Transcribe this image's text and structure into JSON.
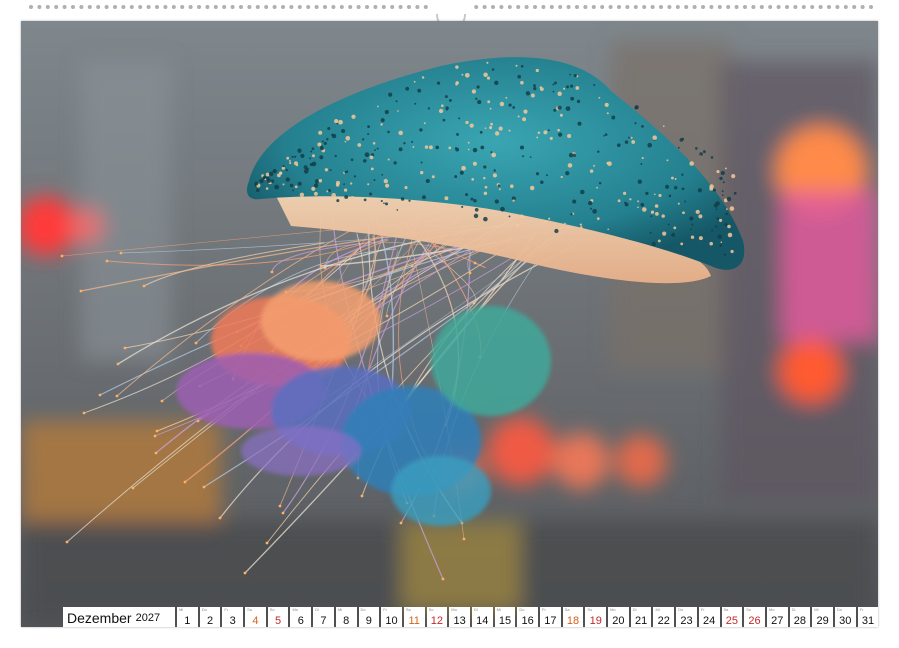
{
  "calendar": {
    "month": "Dezember",
    "year": "2027",
    "days": [
      {
        "n": "1",
        "wd": "Mi",
        "type": "weekday"
      },
      {
        "n": "2",
        "wd": "Do",
        "type": "weekday"
      },
      {
        "n": "3",
        "wd": "Fr",
        "type": "weekday"
      },
      {
        "n": "4",
        "wd": "Sa",
        "type": "sat"
      },
      {
        "n": "5",
        "wd": "So",
        "type": "sun"
      },
      {
        "n": "6",
        "wd": "Mo",
        "type": "weekday"
      },
      {
        "n": "7",
        "wd": "Di",
        "type": "weekday"
      },
      {
        "n": "8",
        "wd": "Mi",
        "type": "weekday"
      },
      {
        "n": "9",
        "wd": "Do",
        "type": "weekday"
      },
      {
        "n": "10",
        "wd": "Fr",
        "type": "weekday"
      },
      {
        "n": "11",
        "wd": "Sa",
        "type": "sat"
      },
      {
        "n": "12",
        "wd": "So",
        "type": "sun"
      },
      {
        "n": "13",
        "wd": "Mo",
        "type": "weekday"
      },
      {
        "n": "14",
        "wd": "Di",
        "type": "weekday"
      },
      {
        "n": "15",
        "wd": "Mi",
        "type": "weekday"
      },
      {
        "n": "16",
        "wd": "Do",
        "type": "weekday"
      },
      {
        "n": "17",
        "wd": "Fr",
        "type": "weekday"
      },
      {
        "n": "18",
        "wd": "Sa",
        "type": "sat"
      },
      {
        "n": "19",
        "wd": "So",
        "type": "sun"
      },
      {
        "n": "20",
        "wd": "Mo",
        "type": "weekday"
      },
      {
        "n": "21",
        "wd": "Di",
        "type": "weekday"
      },
      {
        "n": "22",
        "wd": "Mi",
        "type": "weekday"
      },
      {
        "n": "23",
        "wd": "Do",
        "type": "weekday"
      },
      {
        "n": "24",
        "wd": "Fr",
        "type": "weekday"
      },
      {
        "n": "25",
        "wd": "Sa",
        "type": "sun"
      },
      {
        "n": "26",
        "wd": "So",
        "type": "sun"
      },
      {
        "n": "27",
        "wd": "Mo",
        "type": "weekday"
      },
      {
        "n": "28",
        "wd": "Di",
        "type": "weekday"
      },
      {
        "n": "29",
        "wd": "Mi",
        "type": "weekday"
      },
      {
        "n": "30",
        "wd": "Do",
        "type": "weekday"
      },
      {
        "n": "31",
        "wd": "Fr",
        "type": "weekday"
      }
    ]
  },
  "colors": {
    "saturday": "#d4611a",
    "holiday_sunday": "#c22a2a",
    "jellyfish_bell": "#2a8a9a",
    "background_blur": "#6a6e72"
  },
  "photo": {
    "subject": "jellyfish-illustration"
  }
}
